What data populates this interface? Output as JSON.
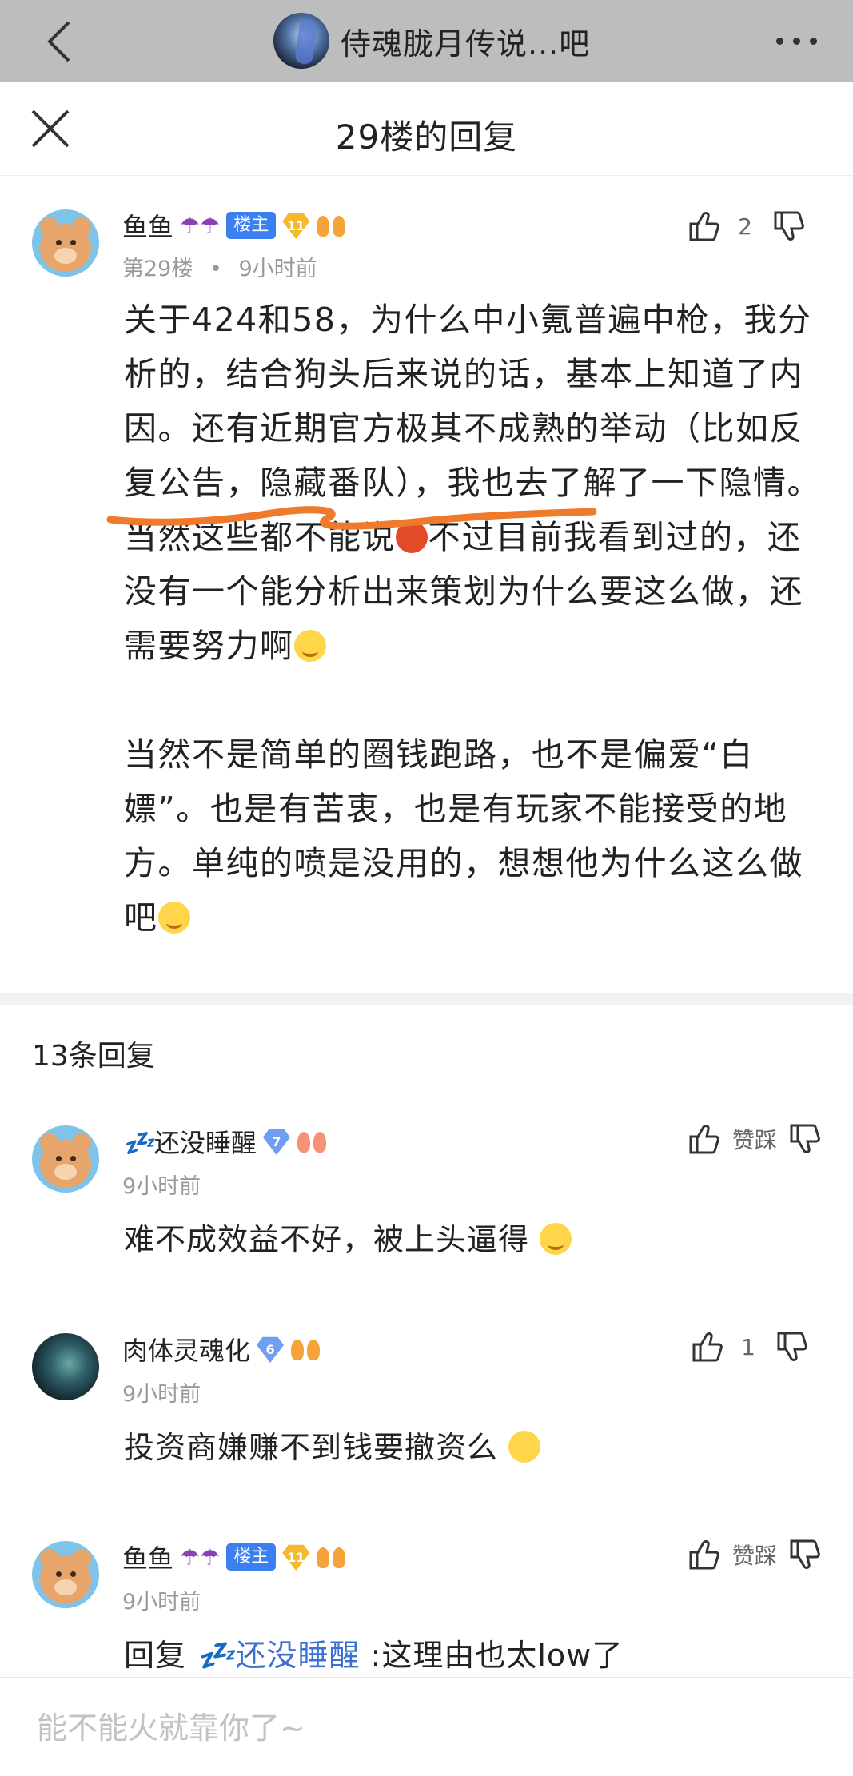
{
  "topbar": {
    "forum_name": "侍魂胧月传说...吧"
  },
  "sheet": {
    "title": "29楼的回复"
  },
  "main_comment": {
    "username": "鱼鱼",
    "host_badge": "楼主",
    "level": "11",
    "floor": "第29楼",
    "separator": "•",
    "time": "9小时前",
    "like_count": "2",
    "paragraph1": "关于424和58，为什么中小氪普遍中枪，我分析的，结合狗头后来说的话，基本上知道了内因。还有近期官方极其不成熟的举动（比如反复公告，隐藏番队），我也去了解了一下隐情。当然这些都不能说",
    "paragraph1_b": "不过目前我看到过的，还没有一个能分析出来策划为什么要这么做，还需要努力啊",
    "paragraph2": "当然不是简单的圈钱跑路，也不是偏爱“白嫖”。也是有苦衷，也是有玩家不能接受的地方。单纯的喷是没用的，想想他为什么这么做吧",
    "underline_color": "#f07a2b"
  },
  "replies_header": "13条回复",
  "replies": [
    {
      "username": "还没睡醒",
      "zz": "💤",
      "level": "7",
      "time": "9小时前",
      "like_label": "赞踩",
      "text": "难不成效益不好，被上头逼得"
    },
    {
      "username": "肉体灵魂化",
      "level": "6",
      "time": "9小时前",
      "like_label": "1",
      "text": "投资商嫌赚不到钱要撤资么"
    },
    {
      "username": "鱼鱼",
      "host_badge": "楼主",
      "level": "11",
      "time": "9小时前",
      "like_label": "赞踩",
      "reply_prefix": "回复",
      "mention": "还没睡醒",
      "text": ":这理由也太low了"
    }
  ],
  "input": {
    "placeholder": "能不能火就靠你了~"
  },
  "colors": {
    "accent": "#3c7ff0",
    "mention": "#3b6fd1",
    "topbar": "#bdbdbd"
  }
}
